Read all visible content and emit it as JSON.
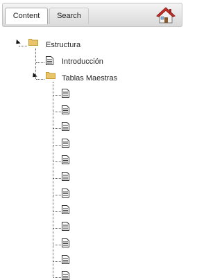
{
  "tabs": {
    "content_label": "Content",
    "search_label": "Search"
  },
  "tree": {
    "root": {
      "label": "Estructura",
      "icon": "folder-open-icon",
      "expanded": true,
      "children": [
        {
          "label": "Introducción",
          "icon": "document-icon"
        },
        {
          "label": "Tablas Maestras",
          "icon": "folder-open-icon",
          "expanded": true,
          "children_count_visible": 12,
          "child_icon": "document-icon"
        }
      ]
    }
  },
  "colors": {
    "folder": "#e9c46a",
    "tabbar_border": "#c3c3c3",
    "tree_line": "#555555"
  }
}
